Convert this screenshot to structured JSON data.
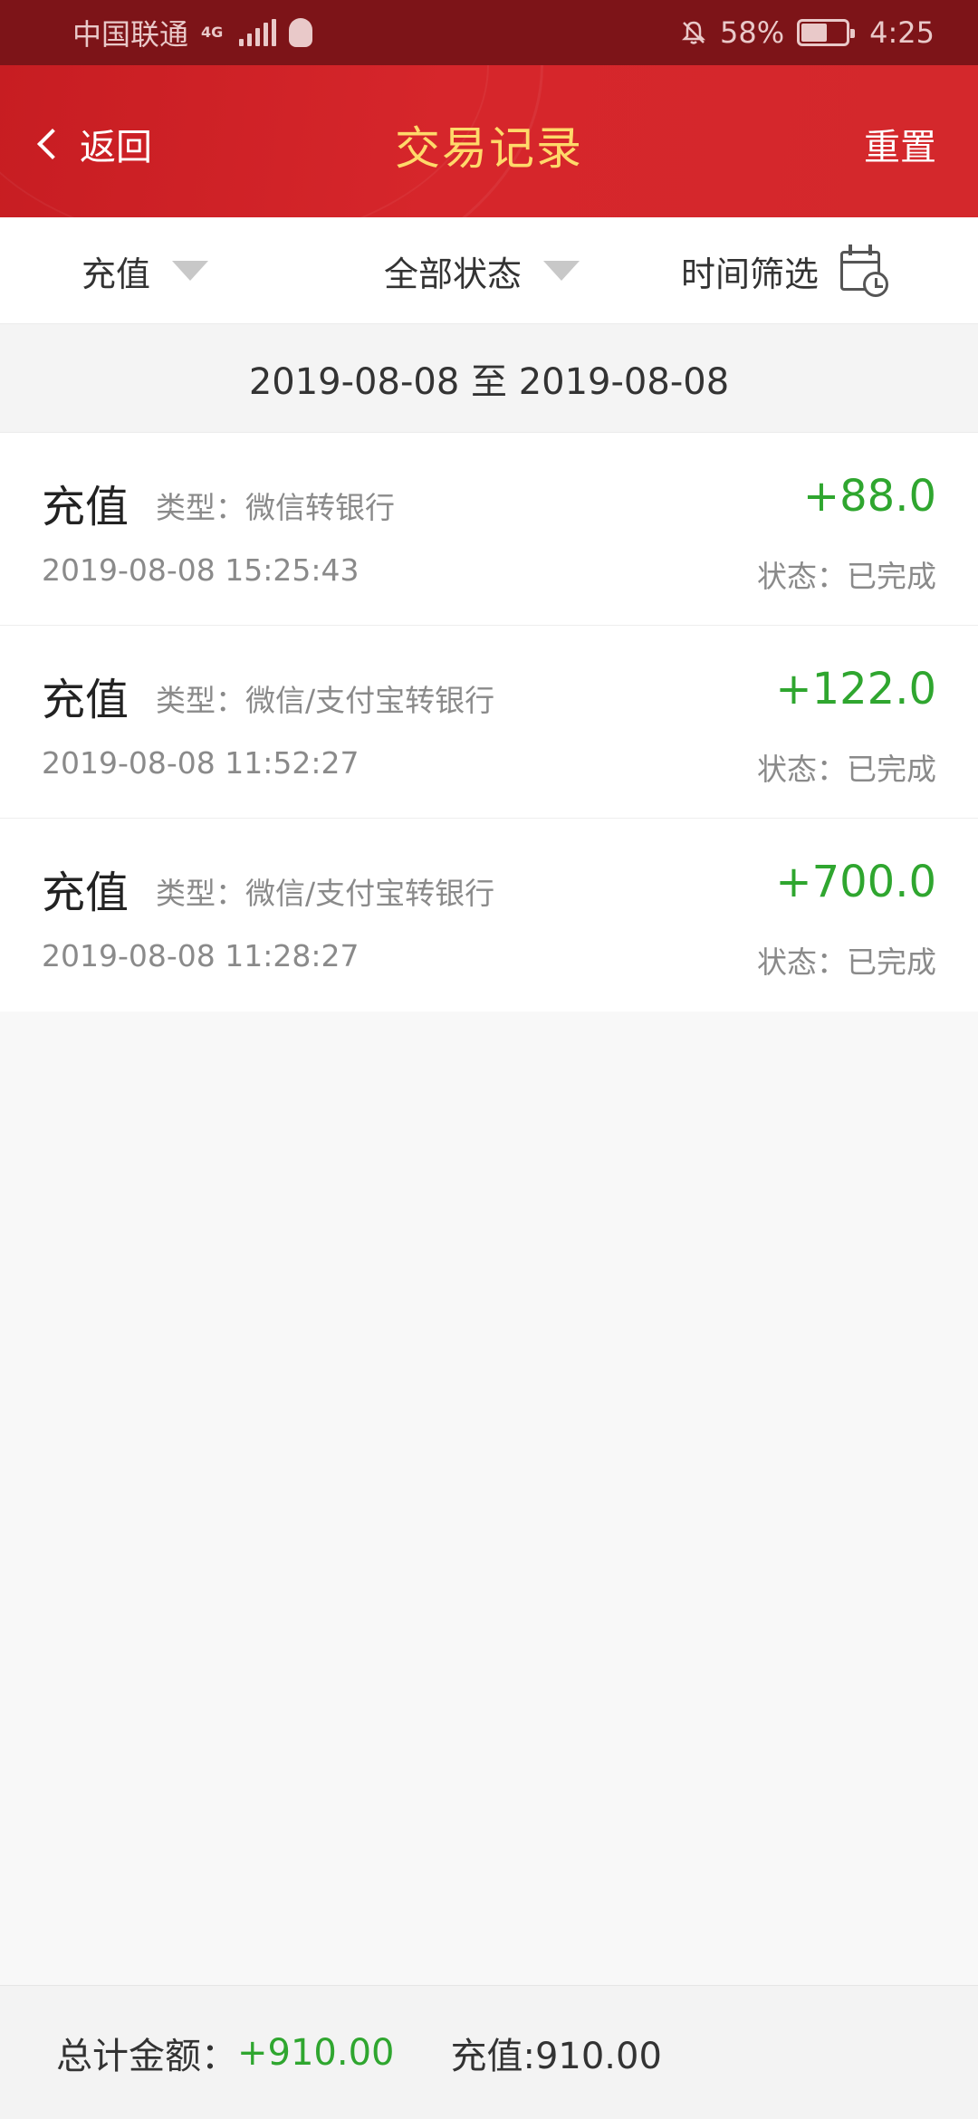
{
  "status_bar": {
    "carrier": "中国联通",
    "network": "4G",
    "battery": "58%",
    "time": "4:25"
  },
  "header": {
    "back_label": "返回",
    "title": "交易记录",
    "reset_label": "重置"
  },
  "filters": {
    "type_label": "充值",
    "status_label": "全部状态",
    "time_label": "时间筛选"
  },
  "date_range": "2019-08-08 至 2019-08-08",
  "records": [
    {
      "title": "充值",
      "type": "类型：微信转银行",
      "amount": "+88.0",
      "time": "2019-08-08 15:25:43",
      "status": "状态：已完成"
    },
    {
      "title": "充值",
      "type": "类型：微信/支付宝转银行",
      "amount": "+122.0",
      "time": "2019-08-08 11:52:27",
      "status": "状态：已完成"
    },
    {
      "title": "充值",
      "type": "类型：微信/支付宝转银行",
      "amount": "+700.0",
      "time": "2019-08-08 11:28:27",
      "status": "状态：已完成"
    }
  ],
  "footer": {
    "total_label": "总计金额：",
    "total_value": "+910.00",
    "recharge_summary": "充值:910.00"
  },
  "colors": {
    "header_red": "#d4262b",
    "title_gold": "#ffd96a",
    "amount_green": "#2fa62f"
  }
}
